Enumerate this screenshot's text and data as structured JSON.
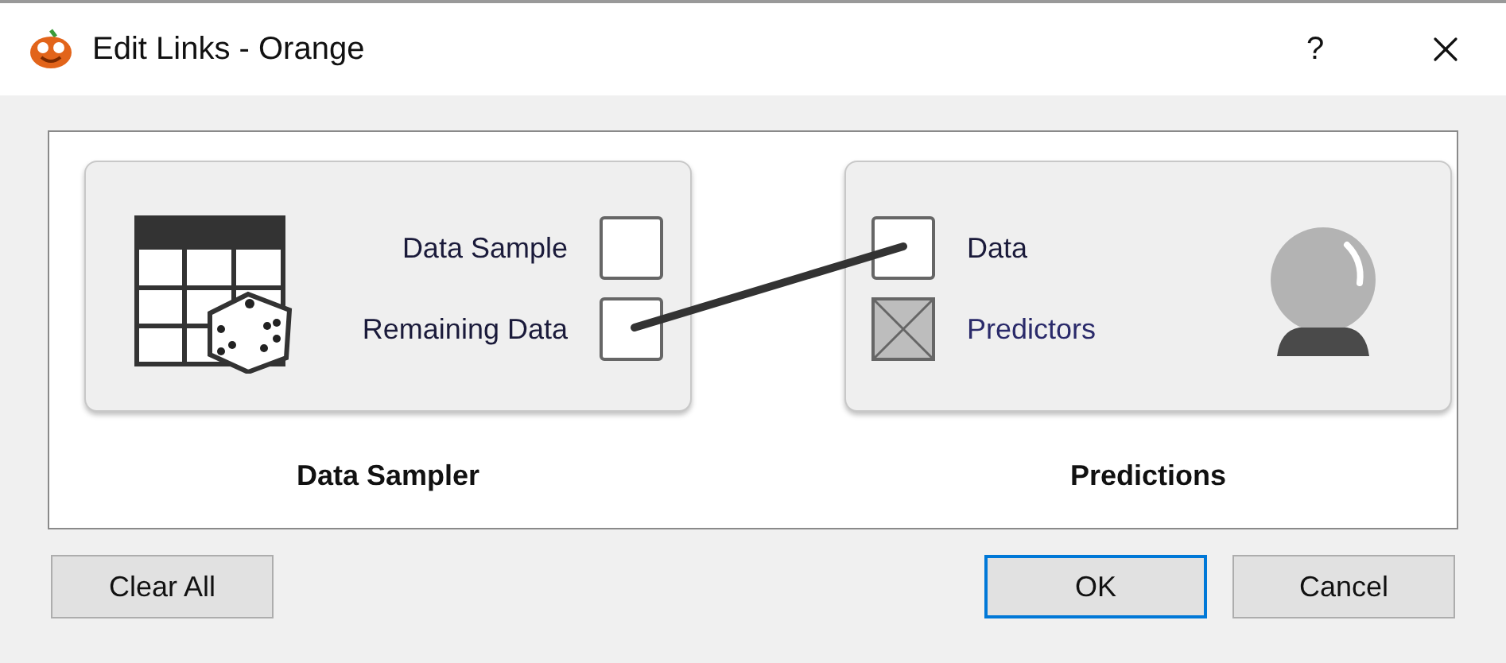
{
  "window": {
    "title": "Edit Links - Orange",
    "help": "?"
  },
  "nodes": [
    {
      "title": "Data Sampler",
      "kind": "source",
      "ports": [
        {
          "label": "Data Sample",
          "disabled": false,
          "connected": false
        },
        {
          "label": "Remaining Data",
          "disabled": false,
          "connected": true
        }
      ]
    },
    {
      "title": "Predictions",
      "kind": "sink",
      "ports": [
        {
          "label": "Data",
          "disabled": false,
          "connected": true
        },
        {
          "label": "Predictors",
          "disabled": true,
          "connected": false
        }
      ]
    }
  ],
  "buttons": [
    {
      "label": "Clear All",
      "focused": false
    },
    {
      "label": "OK",
      "focused": true
    },
    {
      "label": "Cancel",
      "focused": false
    }
  ]
}
